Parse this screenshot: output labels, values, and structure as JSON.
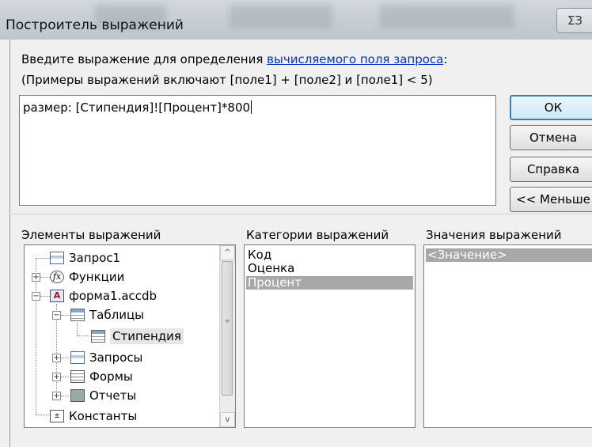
{
  "window": {
    "title": "Построитель выражений",
    "close_glyph": "ΣЗ"
  },
  "prompt": {
    "line1_pre": "Введите выражение для определения ",
    "line1_link": "вычисляемого поля запроса",
    "line1_post": ":",
    "line2": "(Примеры выражений включают [поле1] + [поле2] и [поле1] < 5)"
  },
  "expression": {
    "value": "размер: [Стипендия]![Процент]*800"
  },
  "buttons": {
    "ok": "ОК",
    "cancel": "Отмена",
    "help": "Справка",
    "less": "<< Меньше"
  },
  "panes": {
    "elements_label": "Элементы выражений",
    "categories_label": "Категории выражений",
    "values_label": "Значения выражений"
  },
  "elements_tree": [
    {
      "label": "Запрос1",
      "icon": "query-icon"
    },
    {
      "label": "Функции",
      "icon": "function-icon",
      "expander": "+"
    },
    {
      "label": "форма1.accdb",
      "icon": "database-icon",
      "expander": "−"
    },
    {
      "label": "Таблицы",
      "icon": "table-icon",
      "expander": "−"
    },
    {
      "label": "Стипендия",
      "icon": "table-icon",
      "selected": true
    },
    {
      "label": "Запросы",
      "icon": "query-icon",
      "expander": "+"
    },
    {
      "label": "Формы",
      "icon": "form-icon",
      "expander": "+"
    },
    {
      "label": "Отчеты",
      "icon": "report-icon",
      "expander": "+"
    },
    {
      "label": "Константы",
      "icon": "constant-icon"
    }
  ],
  "categories": [
    {
      "label": "Код"
    },
    {
      "label": "Оценка"
    },
    {
      "label": "Процент",
      "selected": true
    }
  ],
  "values": [
    {
      "label": "<Значение>",
      "selected": true
    }
  ],
  "scrollbar": {
    "up_glyph": "^",
    "down_glyph": "v",
    "grip_glyph": "≡"
  },
  "colors": {
    "selection": "#a8a8a8",
    "link": "#0033cc",
    "ok_border": "#3c7fb1"
  }
}
